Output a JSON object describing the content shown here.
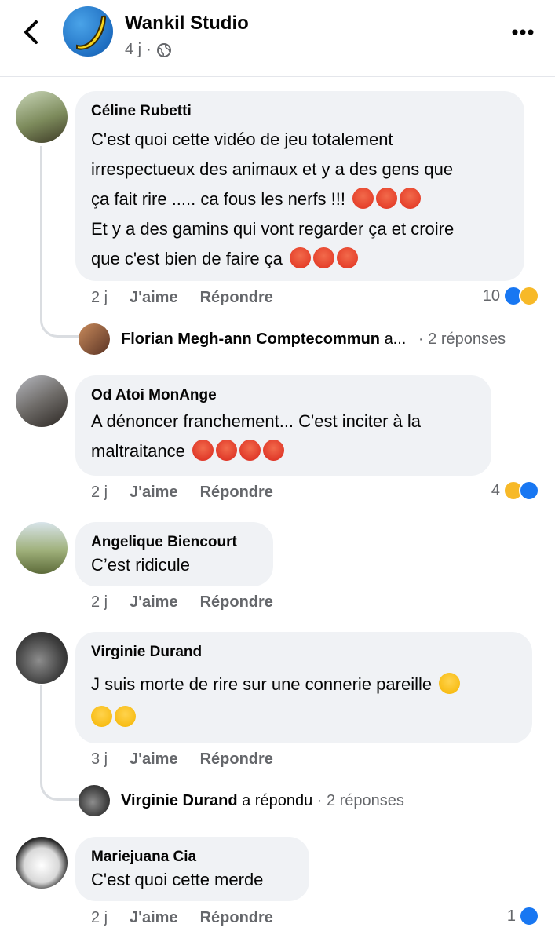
{
  "header": {
    "title": "Wankil Studio",
    "meta_time": "4 j",
    "icons": {
      "back": "chevron-left-icon",
      "privacy": "globe-icon",
      "more": "more-dots-icon"
    }
  },
  "comments": [
    {
      "author": "Céline Rubetti",
      "lines": [
        "C'est quoi cette vidéo de jeu totalement",
        "irrespectueux des animaux et y a des gens que",
        "ça fait rire ..... ca fous les nerfs !!!",
        "Et y a des gamins qui vont regarder ça et croire",
        "que c'est bien de faire ça"
      ],
      "time": "2 j",
      "like_label": "J'aime",
      "reply_label": "Répondre",
      "reaction_count": "10",
      "reply_preview": {
        "name": "Florian Megh-ann Comptecommun",
        "suffix": "a...",
        "count": "· 2 réponses"
      }
    },
    {
      "author": "Od Atoi MonAnge",
      "lines": [
        "A dénoncer franchement... C'est inciter à la",
        "maltraitance"
      ],
      "time": "2 j",
      "like_label": "J'aime",
      "reply_label": "Répondre",
      "reaction_count": "4"
    },
    {
      "author": "Angelique Biencourt",
      "lines": [
        "C’est ridicule"
      ],
      "time": "2 j",
      "like_label": "J'aime",
      "reply_label": "Répondre"
    },
    {
      "author": "Virginie Durand",
      "lines": [
        "J suis morte de rire sur une connerie pareille"
      ],
      "time": "3 j",
      "like_label": "J'aime",
      "reply_label": "Répondre",
      "reply_preview": {
        "name": "Virginie Durand",
        "suffix": "a répondu",
        "count": "· 2 réponses"
      }
    },
    {
      "author": "Mariejuana Cia",
      "lines": [
        "C'est quoi cette merde"
      ],
      "time": "2 j",
      "like_label": "J'aime",
      "reply_label": "Répondre",
      "reaction_count": "1"
    }
  ]
}
